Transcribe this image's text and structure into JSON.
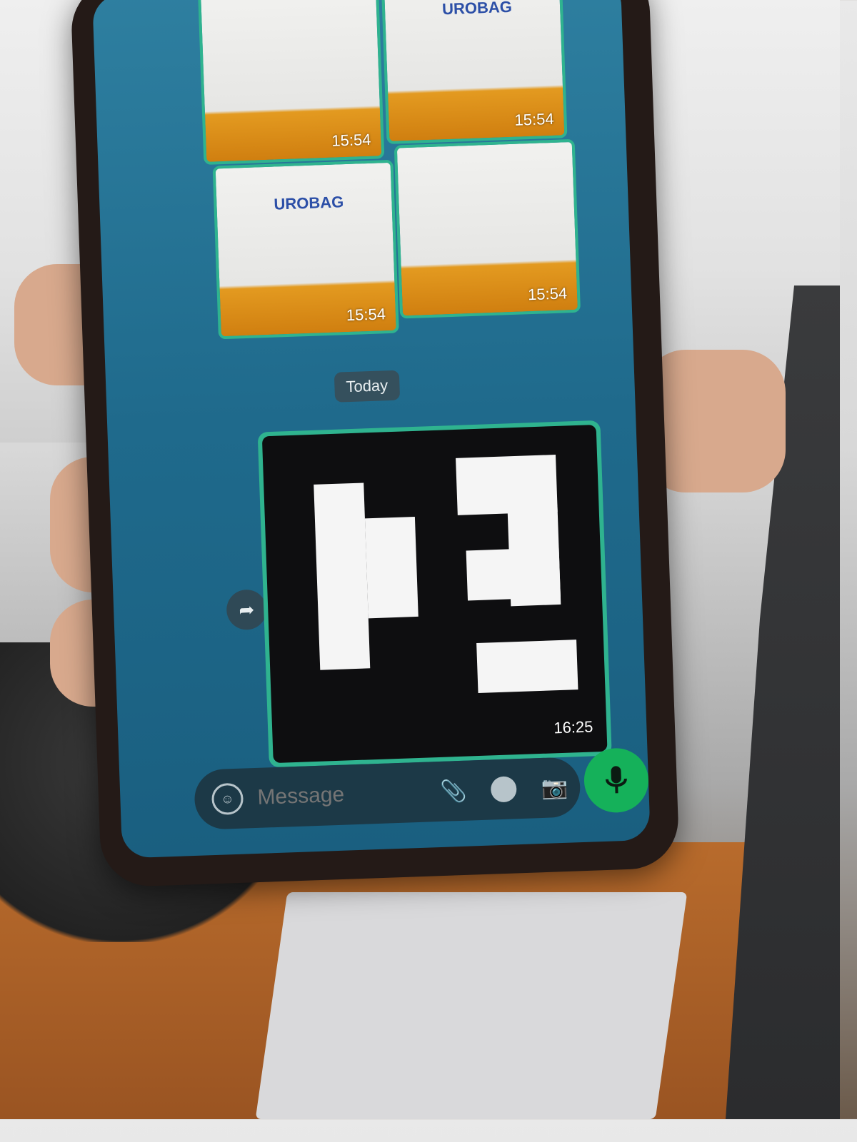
{
  "chat": {
    "photos": [
      {
        "brand": "",
        "time": "15:54"
      },
      {
        "brand": "UROBAG",
        "time": "15:54"
      },
      {
        "brand": "UROBAG",
        "time": "15:54"
      },
      {
        "brand": "",
        "time": "15:54"
      }
    ],
    "date_divider": "Today",
    "image_message": {
      "time": "16:25"
    }
  },
  "composer": {
    "placeholder": "Message"
  },
  "colors": {
    "accent_green": "#15b15a",
    "bubble_border": "#2fb38f",
    "chat_bg": "#1f6a8c"
  },
  "icons": [
    "emoji-icon",
    "attach-icon",
    "rupee-icon",
    "camera-icon",
    "mic-icon",
    "forward-icon"
  ]
}
